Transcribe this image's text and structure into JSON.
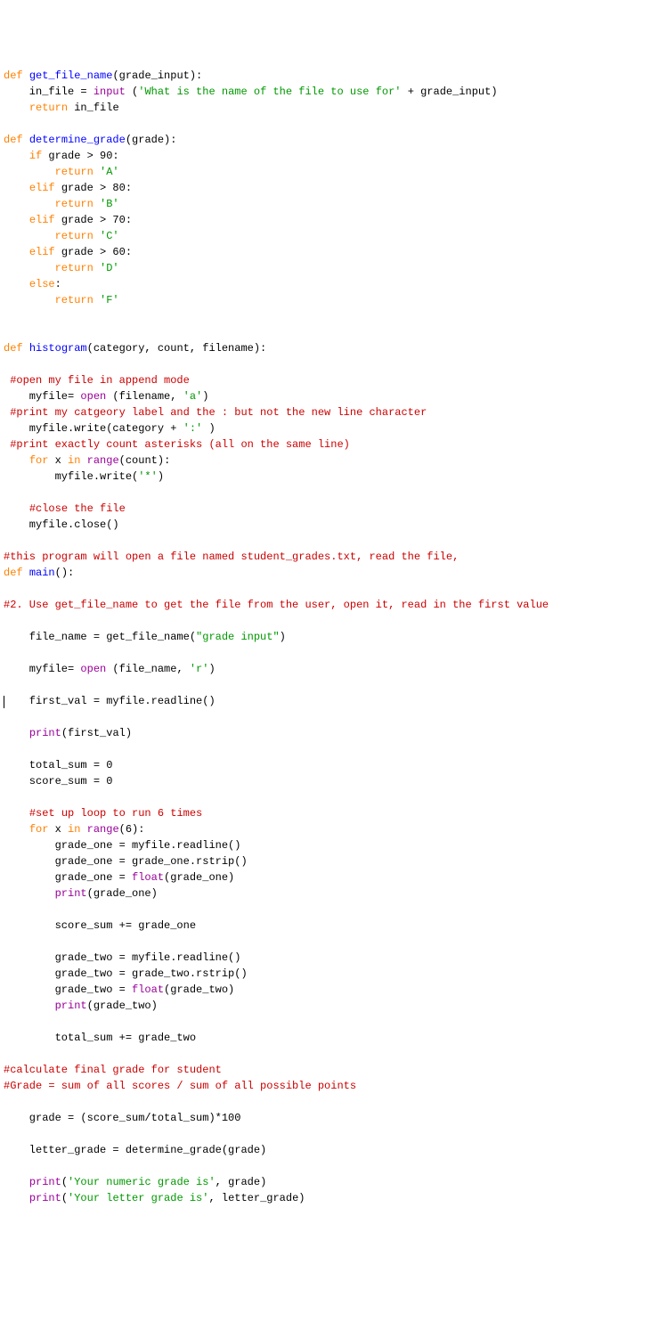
{
  "tokens": {
    "def": "def",
    "if": "if",
    "elif": "elif",
    "else": "else",
    "for": "for",
    "in": "in",
    "return": "return",
    "input": "input",
    "open": "open",
    "print": "print",
    "float": "float",
    "range": "range"
  },
  "functions": {
    "get_file_name": "get_file_name",
    "determine_grade": "determine_grade",
    "histogram": "histogram",
    "main": "main"
  },
  "strings": {
    "prompt": "'What is the name of the file to use for'",
    "gA": "'A'",
    "gB": "'B'",
    "gC": "'C'",
    "gD": "'D'",
    "gF": "'F'",
    "mode_a": "'a'",
    "colon": "':'",
    "star": "'*'",
    "grade_input": "\"grade input\"",
    "mode_r": "'r'",
    "numeric_msg": "'Your numeric grade is'",
    "letter_msg": "'Your letter grade is'"
  },
  "comments": {
    "open_append": " #open my file in append mode",
    "print_label": " #print my catgeory label and the : but not the new line character",
    "print_asterisks": " #print exactly count asterisks (all on the same line)",
    "close_file": "#close the file",
    "program_desc": "#this program will open a file named student_grades.txt, read the file,",
    "step2": "#2. Use get_file_name to get the file from the user, open it, read in the first value",
    "loop6": "#set up loop to run 6 times",
    "calc_final": "#calculate final grade for student",
    "grade_formula": "#Grade = sum of all scores / sum of all possible points"
  },
  "code": {
    "gfn_params": "(grade_input):",
    "gfn_line2a": "    in_file = ",
    "gfn_line2b": " (",
    "gfn_line2c": " + grade_input)",
    "gfn_line3": " in_file",
    "dg_params": "(grade):",
    "cond90": " grade > 90:",
    "cond80": " grade > 80:",
    "cond70": " grade > 70:",
    "cond60": " grade > 60:",
    "else_colon": ":",
    "ret_indent": "        ",
    "hist_params": "(category, count, filename):",
    "hist_open": "    myfile= ",
    "hist_open2": " (filename, ",
    "hist_open3": ")",
    "hist_write": "    myfile.write(category + ",
    "hist_write2": " )",
    "for_x": " x ",
    "range_count": "(count):",
    "write_star": "        myfile.write(",
    "write_star2": ")",
    "close": "    myfile.close()",
    "main_params": "():",
    "file_name_assign": "    file_name = get_file_name(",
    "file_name_assign2": ")",
    "myfile_open": "    myfile= ",
    "myfile_open2": " (file_name, ",
    "myfile_open3": ")",
    "first_val": "    first_val = myfile.readline()",
    "print_fv": "(first_val)",
    "total0": "    total_sum = 0",
    "score0": "    score_sum = 0",
    "range6": "(6):",
    "g1_read": "        grade_one = myfile.readline()",
    "g1_strip": "        grade_one = grade_one.rstrip()",
    "g1_float": "        grade_one = ",
    "g1_float2": "(grade_one)",
    "print_g1": "(grade_one)",
    "score_add": "        score_sum += grade_one",
    "g2_read": "        grade_two = myfile.readline()",
    "g2_strip": "        grade_two = grade_two.rstrip()",
    "g2_float": "        grade_two = ",
    "g2_float2": "(grade_two)",
    "print_g2": "(grade_two)",
    "total_add": "        total_sum += grade_two",
    "grade_calc": "    grade = (score_sum/total_sum)*100",
    "lg_assign": "    letter_grade = determine_grade(grade)",
    "print_num2": ", grade)",
    "print_let2": ", letter_grade)",
    "indent4": "    ",
    "indent8": "        ",
    "open_paren": "(",
    "space": " "
  }
}
